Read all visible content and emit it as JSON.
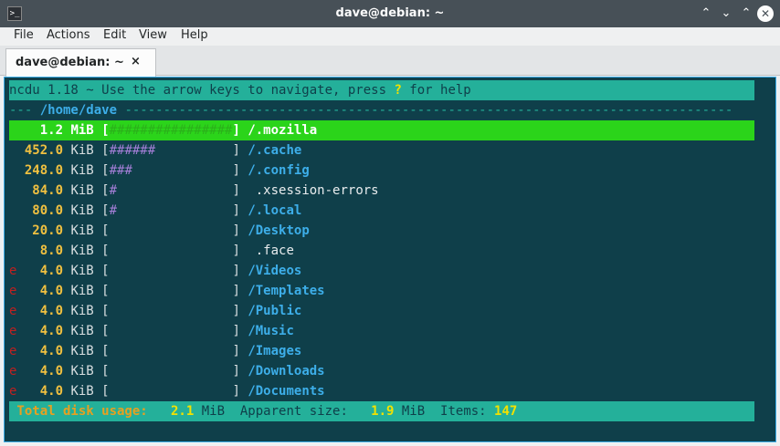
{
  "window": {
    "title": "dave@debian: ~",
    "buttons": [
      "⌃",
      "⌄",
      "⌃",
      "✕"
    ]
  },
  "menu": [
    "File",
    "Actions",
    "Edit",
    "View",
    "Help"
  ],
  "tab": {
    "label": "dave@debian: ~",
    "close": "×"
  },
  "ncdu": {
    "header_pre": "ncdu 1.18 ~ Use the arrow keys to navigate, press ",
    "header_key": "?",
    "header_post": " for help",
    "path_prefix": "--- ",
    "path": "/home/dave",
    "path_suffix": " -------------------------------------------------------------------------------",
    "entries": [
      {
        "flag": " ",
        "size": "   1.2",
        "unit": " MiB",
        "bar": "################",
        "name": "/.mozilla",
        "type": "dir",
        "selected": true
      },
      {
        "flag": " ",
        "size": " 452.0",
        "unit": " KiB",
        "bar": "######          ",
        "name": "/.cache",
        "type": "dir"
      },
      {
        "flag": " ",
        "size": " 248.0",
        "unit": " KiB",
        "bar": "###             ",
        "name": "/.config",
        "type": "dir"
      },
      {
        "flag": " ",
        "size": "  84.0",
        "unit": " KiB",
        "bar": "#               ",
        "name": " .xsession-errors",
        "type": "file"
      },
      {
        "flag": " ",
        "size": "  80.0",
        "unit": " KiB",
        "bar": "#               ",
        "name": "/.local",
        "type": "dir"
      },
      {
        "flag": " ",
        "size": "  20.0",
        "unit": " KiB",
        "bar": "                ",
        "name": "/Desktop",
        "type": "dir"
      },
      {
        "flag": " ",
        "size": "   8.0",
        "unit": " KiB",
        "bar": "                ",
        "name": " .face",
        "type": "file"
      },
      {
        "flag": "e",
        "size": "   4.0",
        "unit": " KiB",
        "bar": "                ",
        "name": "/Videos",
        "type": "dir"
      },
      {
        "flag": "e",
        "size": "   4.0",
        "unit": " KiB",
        "bar": "                ",
        "name": "/Templates",
        "type": "dir"
      },
      {
        "flag": "e",
        "size": "   4.0",
        "unit": " KiB",
        "bar": "                ",
        "name": "/Public",
        "type": "dir"
      },
      {
        "flag": "e",
        "size": "   4.0",
        "unit": " KiB",
        "bar": "                ",
        "name": "/Music",
        "type": "dir"
      },
      {
        "flag": "e",
        "size": "   4.0",
        "unit": " KiB",
        "bar": "                ",
        "name": "/Images",
        "type": "dir"
      },
      {
        "flag": "e",
        "size": "   4.0",
        "unit": " KiB",
        "bar": "                ",
        "name": "/Downloads",
        "type": "dir"
      },
      {
        "flag": "e",
        "size": "   4.0",
        "unit": " KiB",
        "bar": "                ",
        "name": "/Documents",
        "type": "dir"
      }
    ],
    "footer": {
      "total_label": " Total disk usage:",
      "total_value": "   2.1",
      "total_unit": " MiB",
      "apparent_label": "  Apparent size:",
      "apparent_value": "   1.9",
      "apparent_unit": " MiB",
      "items_label": "  Items:",
      "items_value": " 147"
    }
  },
  "colors": {
    "terminal_bg": "#0f3f4a",
    "bar_accent": "#24b09a",
    "selected_row": "#2bd41a",
    "size_color": "#f0c040",
    "dir_color": "#3daee9"
  }
}
